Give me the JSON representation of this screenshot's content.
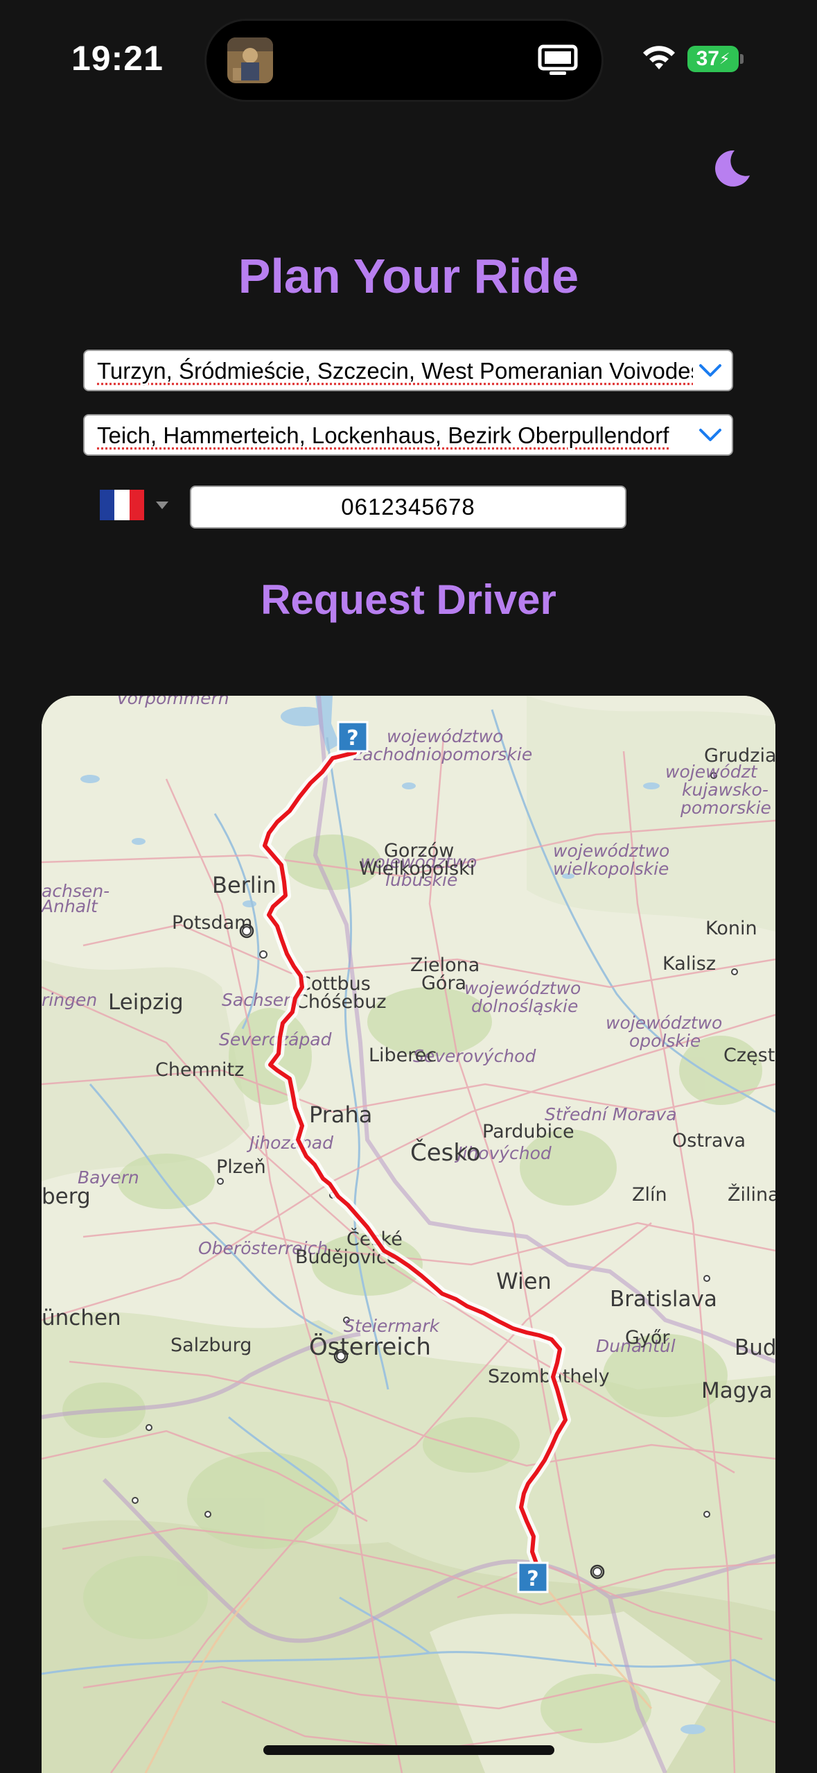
{
  "status_bar": {
    "time": "19:21",
    "battery": "37",
    "icons": [
      "wifi-icon",
      "battery-icon",
      "screen-mirroring-icon"
    ]
  },
  "header": {
    "theme_toggle_icon": "moon-icon",
    "title": "Plan Your Ride"
  },
  "form": {
    "origin": "Turzyn, Śródmieście, Szczecin, West Pomeranian Voivodeship",
    "destination": "Teich, Hammerteich, Lockenhaus, Bezirk Oberpullendorf",
    "country_flag": "France",
    "phone": "0612345678",
    "request_label": "Request Driver"
  },
  "colors": {
    "accent": "#b87ff0",
    "background": "#141414",
    "route": "#e8141c",
    "chevron": "#1a7cf0"
  },
  "map": {
    "markers": [
      "start-marker",
      "end-marker"
    ],
    "marker_symbol": "?",
    "labels": {
      "vorpommern": "Vorpommern",
      "zachodnio_1": "województwo",
      "zachodnio_2": "zachodniopomorskie",
      "grudziadz": "Grudzia",
      "kujawsko_1": "województ",
      "kujawsko_2": "kujawsko-",
      "kujawsko_3": "pomorskie",
      "gorzow_1": "Gorzów",
      "gorzow_2": "Wielkopolski",
      "berlin": "Berlin",
      "potsdam": "Potsdam",
      "wielko_1": "województwo",
      "wielko_2": "wielkopolskie",
      "lubuskie_1": "województwo",
      "lubuskie_2": "lubuskie",
      "konin": "Konin",
      "sachsen_anhalt_1": "achsen-",
      "sachsen_anhalt_2": "Anhalt",
      "kalisz": "Kalisz",
      "zielona_1": "Zielona",
      "zielona_2": "Góra",
      "cottbus_1": "Cottbus",
      "cottbus_2": "Chóśebuz",
      "leipzig": "Leipzig",
      "dolno_1": "województwo",
      "dolno_2": "dolnośląskie",
      "sachsen": "Sachsen",
      "thuringen": "ringen",
      "liberec": "Liberec",
      "czestochowa": "Częst",
      "chemnitz": "Chemnitz",
      "opolskie_1": "województwo",
      "opolskie_2": "opolskie",
      "severozapad": "Severozápad",
      "severovychod": "Severovýchod",
      "praha": "Praha",
      "pardubice": "Pardubice",
      "ostrava": "Ostrava",
      "cesko": "Česko",
      "plzen": "Plzeň",
      "stredni_morava": "Střední Morava",
      "jihozapad": "Jihozápad",
      "jihovychod": "Jihovýchod",
      "zlin": "Zlín",
      "zilina": "Žilina",
      "berg": "berg",
      "bayern": "Bayern",
      "ceske_1": "České",
      "ceske_2": "Budějovice",
      "wien": "Wien",
      "bratislava": "Bratislava",
      "oberosterreich": "Oberösterreich",
      "munchen": "ünchen",
      "gyor": "Győr",
      "salzburg": "Salzburg",
      "osterreich": "Österreich",
      "budapest": "Buda",
      "szombathely": "Szombathely",
      "steiermark": "Steiermark",
      "magyar": "Magya",
      "dunantul": "Dunántúl"
    }
  }
}
